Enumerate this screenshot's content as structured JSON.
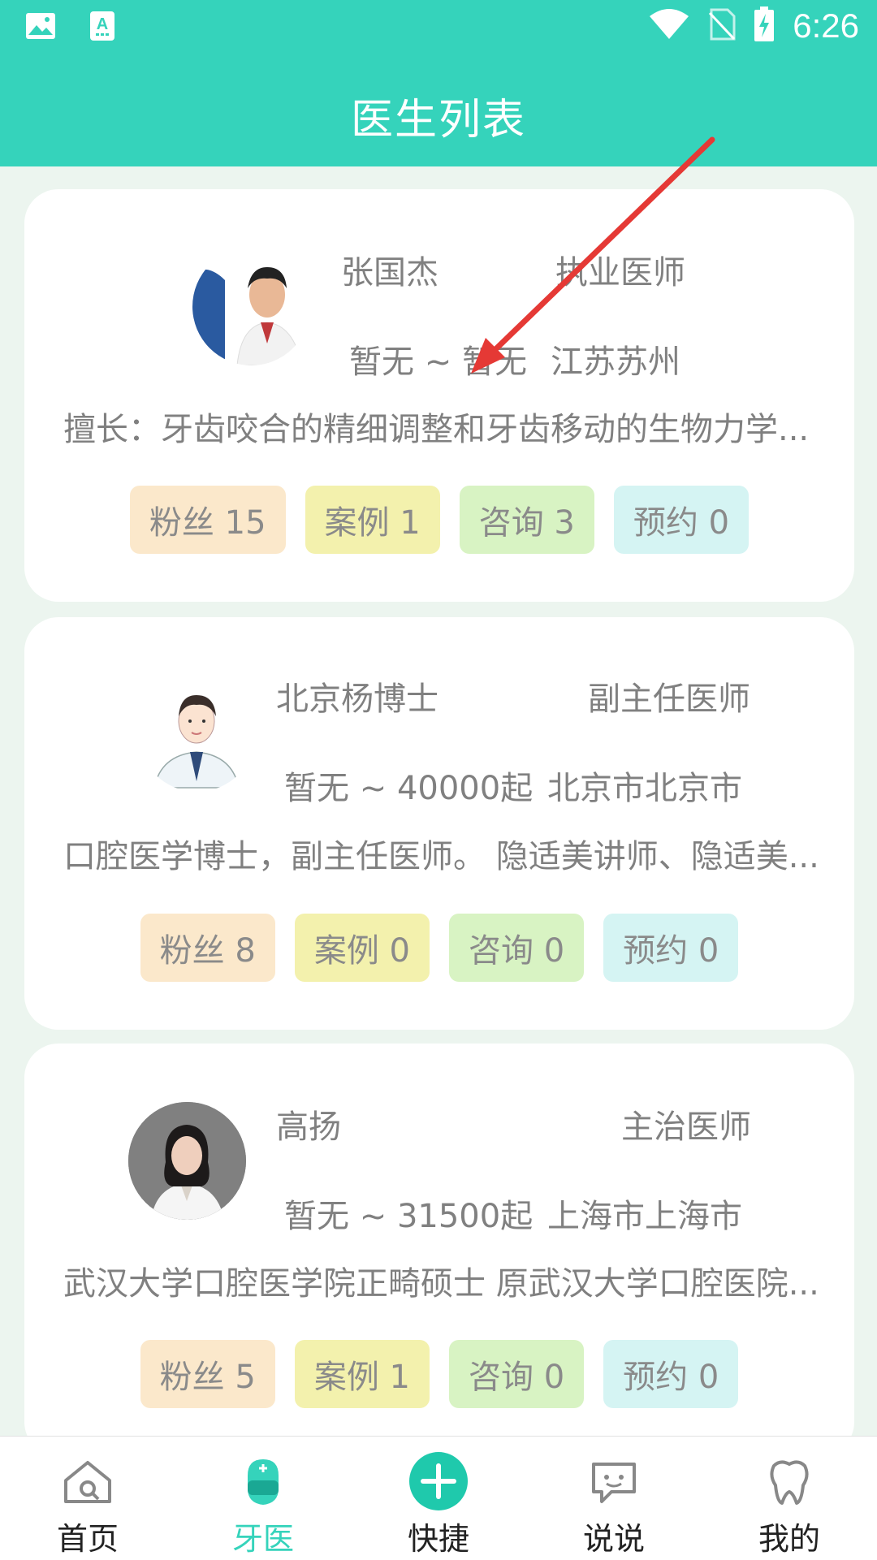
{
  "status_bar": {
    "time": "6:26"
  },
  "header": {
    "title": "医生列表"
  },
  "doctors": [
    {
      "name": "张国杰",
      "rank": "执业医师",
      "price": "暂无 ~ 暂无",
      "city": "江苏苏州",
      "desc": "擅长：牙齿咬合的精细调整和牙齿移动的生物力学...",
      "stats": {
        "fans": "粉丝 15",
        "cases": "案例 1",
        "consult": "咨询 3",
        "appoint": "预约 0"
      }
    },
    {
      "name": "北京杨博士",
      "rank": "副主任医师",
      "price": "暂无 ~ 40000起",
      "city": "北京市北京市",
      "desc": "口腔医学博士，副主任医师。 隐适美讲师、隐适美...",
      "stats": {
        "fans": "粉丝 8",
        "cases": "案例 0",
        "consult": "咨询 0",
        "appoint": "预约 0"
      }
    },
    {
      "name": "高扬",
      "rank": "主治医师",
      "price": "暂无 ~ 31500起",
      "city": "上海市上海市",
      "desc": "武汉大学口腔医学院正畸硕士 原武汉大学口腔医院...",
      "stats": {
        "fans": "粉丝 5",
        "cases": "案例 1",
        "consult": "咨询 0",
        "appoint": "预约 0"
      }
    }
  ],
  "bottom_nav": [
    {
      "label": "首页",
      "icon": "home-icon",
      "active": false
    },
    {
      "label": "牙医",
      "icon": "dentist-icon",
      "active": true
    },
    {
      "label": "快捷",
      "icon": "plus-icon",
      "active": false
    },
    {
      "label": "说说",
      "icon": "chat-icon",
      "active": false
    },
    {
      "label": "我的",
      "icon": "tooth-icon",
      "active": false
    }
  ],
  "colors": {
    "primary": "#35d3bb",
    "background": "#ecf5ef",
    "annotation_arrow": "#e53935"
  }
}
